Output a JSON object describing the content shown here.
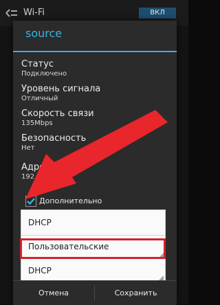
{
  "background": {
    "title": "Wi-Fi",
    "toggle": "ВКЛ"
  },
  "dialog": {
    "title": "source",
    "info": [
      {
        "label": "Статус",
        "value": "Подключено"
      },
      {
        "label": "Уровень сигнала",
        "value": "Отличный"
      },
      {
        "label": "Скорость связи",
        "value": "135Mbps"
      },
      {
        "label": "Безопасность",
        "value": "Нет"
      },
      {
        "label": "Адрес IP",
        "value": "192.168"
      }
    ],
    "advanced_label": "Дополнительно",
    "advanced_checked": true,
    "dropdown": {
      "options": [
        "DHCP",
        "Пользовательские",
        "DHCP"
      ],
      "highlighted_option": "Пользовательские"
    },
    "buttons": {
      "cancel": "Отмена",
      "save": "Сохранить"
    }
  },
  "colors": {
    "accent": "#33b5e5",
    "annotation": "#d2232a"
  }
}
